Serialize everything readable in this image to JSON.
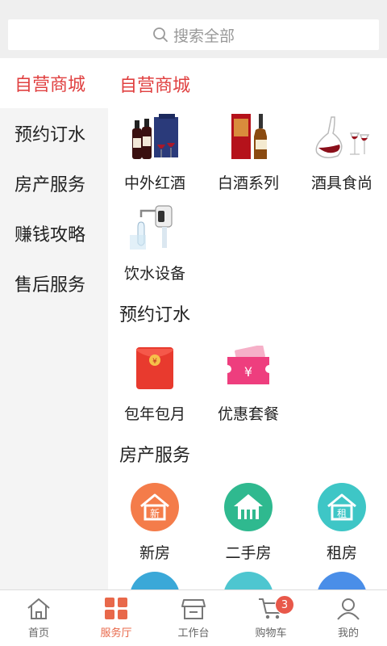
{
  "search": {
    "placeholder": "搜索全部"
  },
  "sidebar": {
    "items": [
      {
        "label": "自营商城",
        "active": true
      },
      {
        "label": "预约订水",
        "active": false
      },
      {
        "label": "房产服务",
        "active": false
      },
      {
        "label": "赚钱攻略",
        "active": false
      },
      {
        "label": "售后服务",
        "active": false
      }
    ]
  },
  "sections": {
    "mall": {
      "title": "自营商城",
      "items": [
        {
          "label": "中外红酒",
          "icon": "red-wine-icon"
        },
        {
          "label": "白酒系列",
          "icon": "liquor-bottle-icon"
        },
        {
          "label": "酒具食尚",
          "icon": "decanter-icon"
        },
        {
          "label": "饮水设备",
          "icon": "water-pump-icon"
        }
      ]
    },
    "water": {
      "title": "预约订水",
      "items": [
        {
          "label": "包年包月",
          "icon": "red-envelope-icon"
        },
        {
          "label": "优惠套餐",
          "icon": "coupon-icon"
        }
      ]
    },
    "estate": {
      "title": "房产服务",
      "items": [
        {
          "label": "新房",
          "icon": "new-house-icon",
          "badge_text": "新",
          "color": "#f47c4a"
        },
        {
          "label": "二手房",
          "icon": "second-hand-house-icon",
          "color": "#2fb98f"
        },
        {
          "label": "租房",
          "icon": "rent-house-icon",
          "badge_text": "租",
          "color": "#3ec6c6"
        }
      ]
    }
  },
  "tabbar": {
    "items": [
      {
        "label": "首页",
        "icon": "home-icon",
        "active": false
      },
      {
        "label": "服务厅",
        "icon": "service-hall-icon",
        "active": true
      },
      {
        "label": "工作台",
        "icon": "workbench-icon",
        "active": false
      },
      {
        "label": "购物车",
        "icon": "cart-icon",
        "active": false,
        "badge": "3"
      },
      {
        "label": "我的",
        "icon": "user-icon",
        "active": false
      }
    ]
  },
  "colors": {
    "accent": "#e04040",
    "tab_active": "#e8684a",
    "sidebar_bg": "#f4f4f4"
  }
}
